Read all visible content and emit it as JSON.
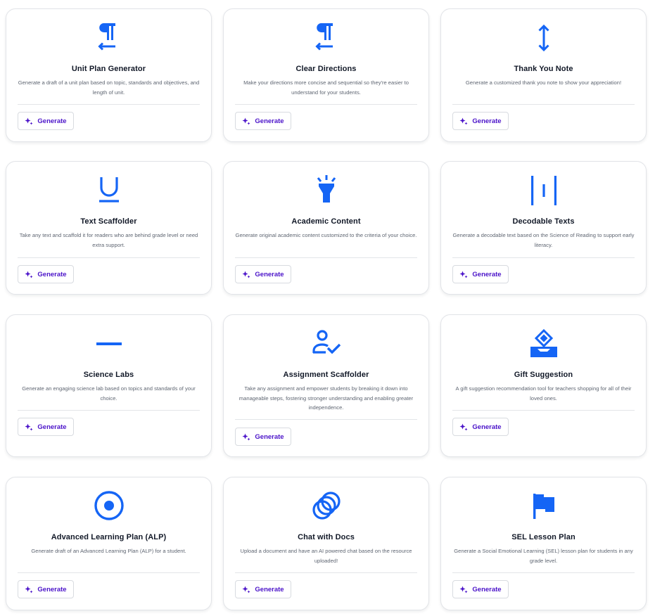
{
  "colors": {
    "icon": "#1565f5",
    "accent": "#4a12c9",
    "border": "#e2e4e8"
  },
  "generate_label": "Generate",
  "tools": [
    {
      "icon": "pilcrow-left-arrow-icon",
      "title": "Unit Plan Generator",
      "description": "Generate a draft of a unit plan based on topic, standards and objectives, and length of unit."
    },
    {
      "icon": "pilcrow-left-arrow-icon",
      "title": "Clear Directions",
      "description": "Make your directions more concise and sequential so they're easier to understand for your students."
    },
    {
      "icon": "vertical-arrows-icon",
      "title": "Thank You Note",
      "description": "Generate a customized thank you note to show your appreciation!"
    },
    {
      "icon": "underline-icon",
      "title": "Text Scaffolder",
      "description": "Take any text and scaffold it for readers who are behind grade level or need extra support."
    },
    {
      "icon": "highlighter-icon",
      "title": "Academic Content",
      "description": "Generate original academic content customized to the criteria of your choice."
    },
    {
      "icon": "text-spacing-icon",
      "title": "Decodable Texts",
      "description": "Generate a decodable text based on the Science of Reading to support early literacy."
    },
    {
      "icon": "horizontal-rule-icon",
      "title": "Science Labs",
      "description": "Generate an engaging science lab based on topics and standards of your choice."
    },
    {
      "icon": "user-check-icon",
      "title": "Assignment Scaffolder",
      "description": "Take any assignment and empower students by breaking it down into manageable steps, fostering stronger understanding and enabling greater independence."
    },
    {
      "icon": "gift-box-icon",
      "title": "Gift Suggestion",
      "description": "A gift suggestion recommendation tool for teachers shopping for all of their loved ones."
    },
    {
      "icon": "radio-target-icon",
      "title": "Advanced Learning Plan (ALP)",
      "description": "Generate draft of an Advanced Learning Plan (ALP) for a student."
    },
    {
      "icon": "linked-rings-icon",
      "title": "Chat with Docs",
      "description": "Upload a document and have an AI powered chat based on the resource uploaded!"
    },
    {
      "icon": "flag-icon",
      "title": "SEL Lesson Plan",
      "description": "Generate a Social Emotional Learning (SEL) lesson plan for students in any grade level."
    }
  ]
}
